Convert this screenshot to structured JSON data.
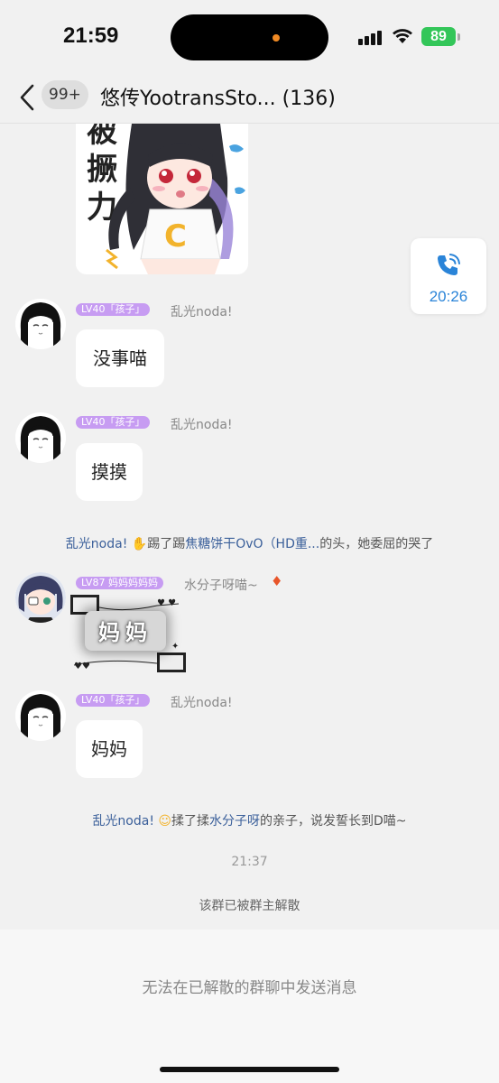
{
  "status_bar": {
    "time": "21:59",
    "battery": "89"
  },
  "header": {
    "unread_badge": "99+",
    "title": "悠传YootransSto... (136)"
  },
  "call_card": {
    "time": "20:26",
    "icon": "phone-icon"
  },
  "sticker": {
    "text": "被\n撅\n力",
    "letter": "C"
  },
  "messages": [
    {
      "level": "LV40「孩子」",
      "sender": "乱光noda!",
      "text": "没事喵"
    },
    {
      "level": "LV40「孩子」",
      "sender": "乱光noda!",
      "text": "摸摸"
    },
    {
      "level": "LV87 妈妈妈妈妈",
      "sender": "水分子呀喵~",
      "text": "妈妈"
    },
    {
      "level": "LV40「孩子」",
      "sender": "乱光noda!",
      "text": "妈妈"
    }
  ],
  "system_1": {
    "actor": "乱光noda!",
    "action": "踢了踢",
    "target": "焦糖饼干OvO（HD重...",
    "rest": "的头，她委屈的哭了"
  },
  "system_2": {
    "actor": "乱光noda!",
    "action": "揉了揉",
    "target": "水分子呀",
    "rest": "的亲子，说发誓长到D喵~"
  },
  "timestamp": "21:37",
  "dissolved_notice": "该群已被群主解散",
  "footer_text": "无法在已解散的群聊中发送消息"
}
